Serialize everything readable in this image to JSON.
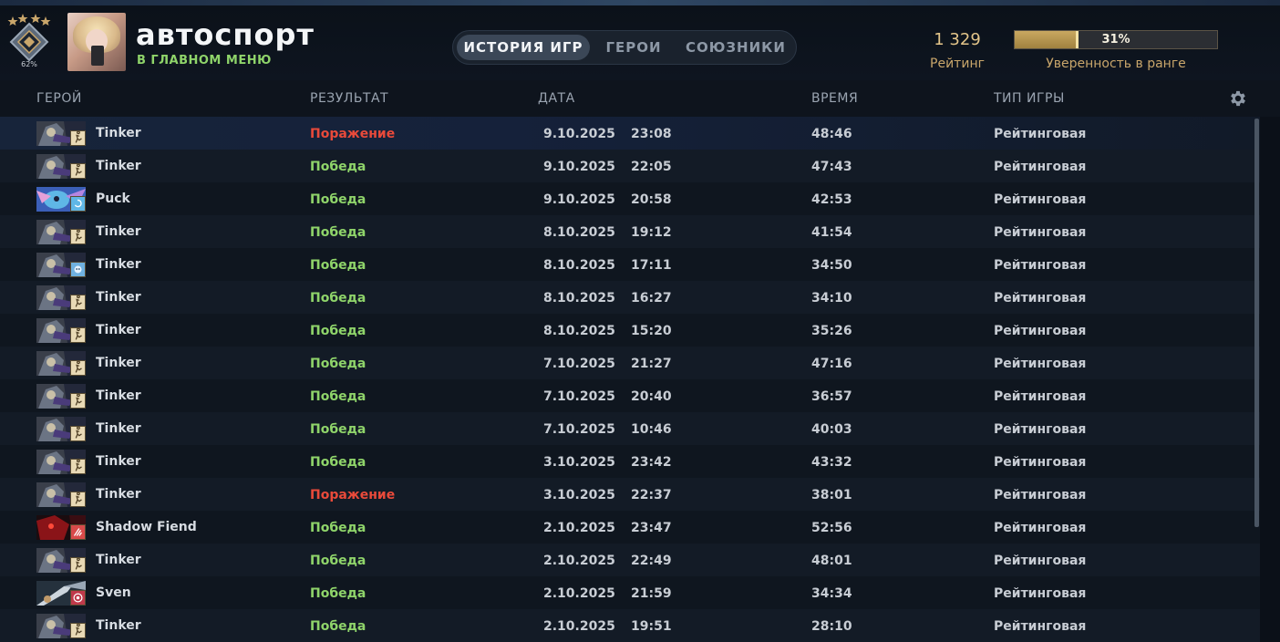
{
  "player": {
    "name": "автоспорт",
    "status": "В ГЛАВНОМ МЕНЮ",
    "medal_percent": "62%"
  },
  "tabs": [
    {
      "label": "ИСТОРИЯ ИГР",
      "active": true
    },
    {
      "label": "ГЕРОИ",
      "active": false
    },
    {
      "label": "СОЮЗНИКИ",
      "active": false
    }
  ],
  "rating": {
    "value": "1 329",
    "label": "Рейтинг"
  },
  "confidence": {
    "percent": 31,
    "text": "31%",
    "label": "Уверенность в ранге"
  },
  "columns": {
    "hero": "ГЕРОЙ",
    "result": "РЕЗУЛЬТАТ",
    "date": "ДАТА",
    "duration": "ВРЕМЯ",
    "game_type": "ТИП ИГРЫ"
  },
  "colors": {
    "win": "#8fd46a",
    "loss": "#e94a3a",
    "gold": "#c9a66b"
  },
  "matches": [
    {
      "hero": "Tinker",
      "hero_icon": "tinker-portrait-icon",
      "role_icon": "run-icon",
      "result": "Поражение",
      "win": false,
      "date": "9.10.2025",
      "time": "23:08",
      "duration": "48:46",
      "type": "Рейтинговая"
    },
    {
      "hero": "Tinker",
      "hero_icon": "tinker-portrait-icon",
      "role_icon": "run-icon",
      "result": "Победа",
      "win": true,
      "date": "9.10.2025",
      "time": "22:05",
      "duration": "47:43",
      "type": "Рейтинговая"
    },
    {
      "hero": "Puck",
      "hero_icon": "puck-portrait-icon",
      "role_icon": "swirl-icon",
      "result": "Победа",
      "win": true,
      "date": "9.10.2025",
      "time": "20:58",
      "duration": "42:53",
      "type": "Рейтинговая"
    },
    {
      "hero": "Tinker",
      "hero_icon": "tinker-portrait-icon",
      "role_icon": "run-icon",
      "result": "Победа",
      "win": true,
      "date": "8.10.2025",
      "time": "19:12",
      "duration": "41:54",
      "type": "Рейтинговая"
    },
    {
      "hero": "Tinker",
      "hero_icon": "tinker-portrait-icon",
      "role_icon": "mask-icon",
      "result": "Победа",
      "win": true,
      "date": "8.10.2025",
      "time": "17:11",
      "duration": "34:50",
      "type": "Рейтинговая"
    },
    {
      "hero": "Tinker",
      "hero_icon": "tinker-portrait-icon",
      "role_icon": "run-icon",
      "result": "Победа",
      "win": true,
      "date": "8.10.2025",
      "time": "16:27",
      "duration": "34:10",
      "type": "Рейтинговая"
    },
    {
      "hero": "Tinker",
      "hero_icon": "tinker-portrait-icon",
      "role_icon": "run-icon",
      "result": "Победа",
      "win": true,
      "date": "8.10.2025",
      "time": "15:20",
      "duration": "35:26",
      "type": "Рейтинговая"
    },
    {
      "hero": "Tinker",
      "hero_icon": "tinker-portrait-icon",
      "role_icon": "run-icon",
      "result": "Победа",
      "win": true,
      "date": "7.10.2025",
      "time": "21:27",
      "duration": "47:16",
      "type": "Рейтинговая"
    },
    {
      "hero": "Tinker",
      "hero_icon": "tinker-portrait-icon",
      "role_icon": "run-icon",
      "result": "Победа",
      "win": true,
      "date": "7.10.2025",
      "time": "20:40",
      "duration": "36:57",
      "type": "Рейтинговая"
    },
    {
      "hero": "Tinker",
      "hero_icon": "tinker-portrait-icon",
      "role_icon": "run-icon",
      "result": "Победа",
      "win": true,
      "date": "7.10.2025",
      "time": "10:46",
      "duration": "40:03",
      "type": "Рейтинговая"
    },
    {
      "hero": "Tinker",
      "hero_icon": "tinker-portrait-icon",
      "role_icon": "run-icon",
      "result": "Победа",
      "win": true,
      "date": "3.10.2025",
      "time": "23:42",
      "duration": "43:32",
      "type": "Рейтинговая"
    },
    {
      "hero": "Tinker",
      "hero_icon": "tinker-portrait-icon",
      "role_icon": "run-icon",
      "result": "Поражение",
      "win": false,
      "date": "3.10.2025",
      "time": "22:37",
      "duration": "38:01",
      "type": "Рейтинговая"
    },
    {
      "hero": "Shadow Fiend",
      "hero_icon": "shadow-fiend-portrait-icon",
      "role_icon": "claw-icon",
      "result": "Победа",
      "win": true,
      "date": "2.10.2025",
      "time": "23:47",
      "duration": "52:56",
      "type": "Рейтинговая"
    },
    {
      "hero": "Tinker",
      "hero_icon": "tinker-portrait-icon",
      "role_icon": "run-icon",
      "result": "Победа",
      "win": true,
      "date": "2.10.2025",
      "time": "22:49",
      "duration": "48:01",
      "type": "Рейтинговая"
    },
    {
      "hero": "Sven",
      "hero_icon": "sven-portrait-icon",
      "role_icon": "target-icon",
      "result": "Победа",
      "win": true,
      "date": "2.10.2025",
      "time": "21:59",
      "duration": "34:34",
      "type": "Рейтинговая"
    },
    {
      "hero": "Tinker",
      "hero_icon": "tinker-portrait-icon",
      "role_icon": "run-icon",
      "result": "Победа",
      "win": true,
      "date": "2.10.2025",
      "time": "19:51",
      "duration": "28:10",
      "type": "Рейтинговая"
    }
  ]
}
